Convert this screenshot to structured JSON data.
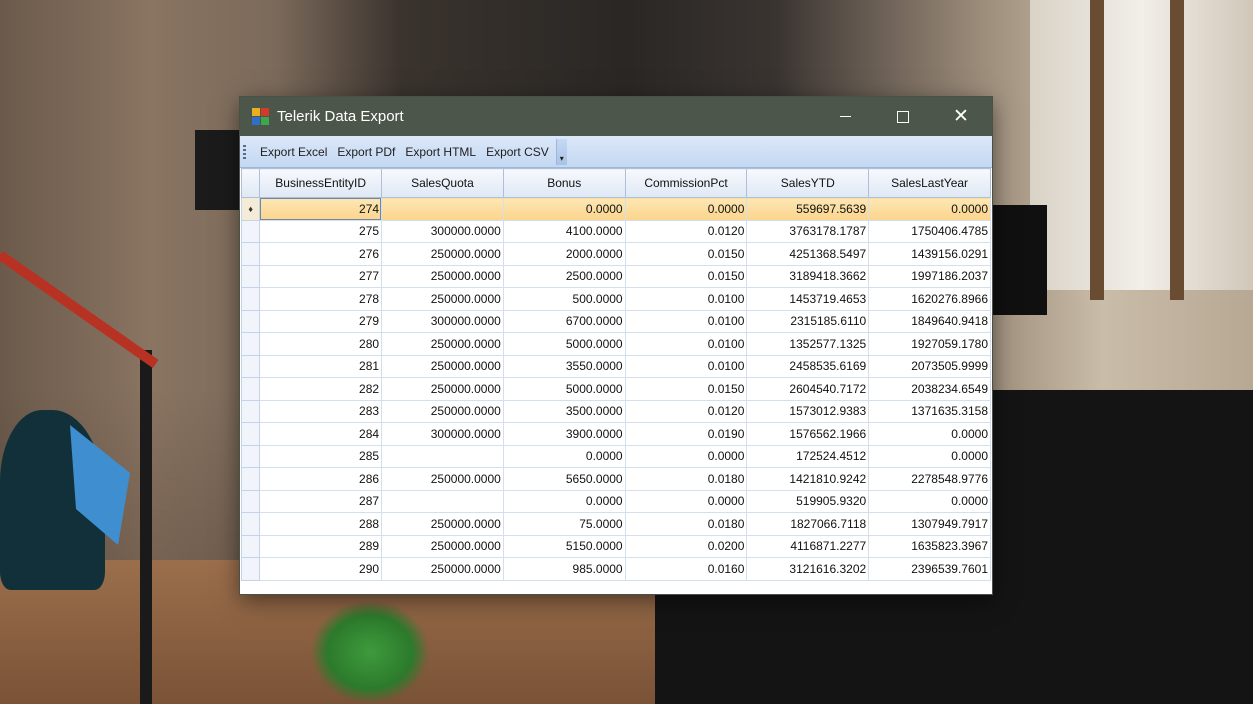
{
  "window": {
    "title": "Telerik Data Export",
    "close_glyph": "✕"
  },
  "toolbar": {
    "items": [
      "Export Excel",
      "Export PDf",
      "Export HTML",
      "Export CSV"
    ],
    "overflow_glyph": "▾"
  },
  "grid": {
    "columns": [
      "BusinessEntityID",
      "SalesQuota",
      "Bonus",
      "CommissionPct",
      "SalesYTD",
      "SalesLastYear"
    ],
    "current_row_indicator": "♦",
    "rows": [
      [
        "274",
        "",
        "0.0000",
        "0.0000",
        "559697.5639",
        "0.0000"
      ],
      [
        "275",
        "300000.0000",
        "4100.0000",
        "0.0120",
        "3763178.1787",
        "1750406.4785"
      ],
      [
        "276",
        "250000.0000",
        "2000.0000",
        "0.0150",
        "4251368.5497",
        "1439156.0291"
      ],
      [
        "277",
        "250000.0000",
        "2500.0000",
        "0.0150",
        "3189418.3662",
        "1997186.2037"
      ],
      [
        "278",
        "250000.0000",
        "500.0000",
        "0.0100",
        "1453719.4653",
        "1620276.8966"
      ],
      [
        "279",
        "300000.0000",
        "6700.0000",
        "0.0100",
        "2315185.6110",
        "1849640.9418"
      ],
      [
        "280",
        "250000.0000",
        "5000.0000",
        "0.0100",
        "1352577.1325",
        "1927059.1780"
      ],
      [
        "281",
        "250000.0000",
        "3550.0000",
        "0.0100",
        "2458535.6169",
        "2073505.9999"
      ],
      [
        "282",
        "250000.0000",
        "5000.0000",
        "0.0150",
        "2604540.7172",
        "2038234.6549"
      ],
      [
        "283",
        "250000.0000",
        "3500.0000",
        "0.0120",
        "1573012.9383",
        "1371635.3158"
      ],
      [
        "284",
        "300000.0000",
        "3900.0000",
        "0.0190",
        "1576562.1966",
        "0.0000"
      ],
      [
        "285",
        "",
        "0.0000",
        "0.0000",
        "172524.4512",
        "0.0000"
      ],
      [
        "286",
        "250000.0000",
        "5650.0000",
        "0.0180",
        "1421810.9242",
        "2278548.9776"
      ],
      [
        "287",
        "",
        "0.0000",
        "0.0000",
        "519905.9320",
        "0.0000"
      ],
      [
        "288",
        "250000.0000",
        "75.0000",
        "0.0180",
        "1827066.7118",
        "1307949.7917"
      ],
      [
        "289",
        "250000.0000",
        "5150.0000",
        "0.0200",
        "4116871.2277",
        "1635823.3967"
      ],
      [
        "290",
        "250000.0000",
        "985.0000",
        "0.0160",
        "3121616.3202",
        "2396539.7601"
      ]
    ]
  },
  "colors": {
    "titlebar": "#4d564b",
    "toolbar": "#c4d8f2",
    "selected_row": "#fbd48a"
  }
}
